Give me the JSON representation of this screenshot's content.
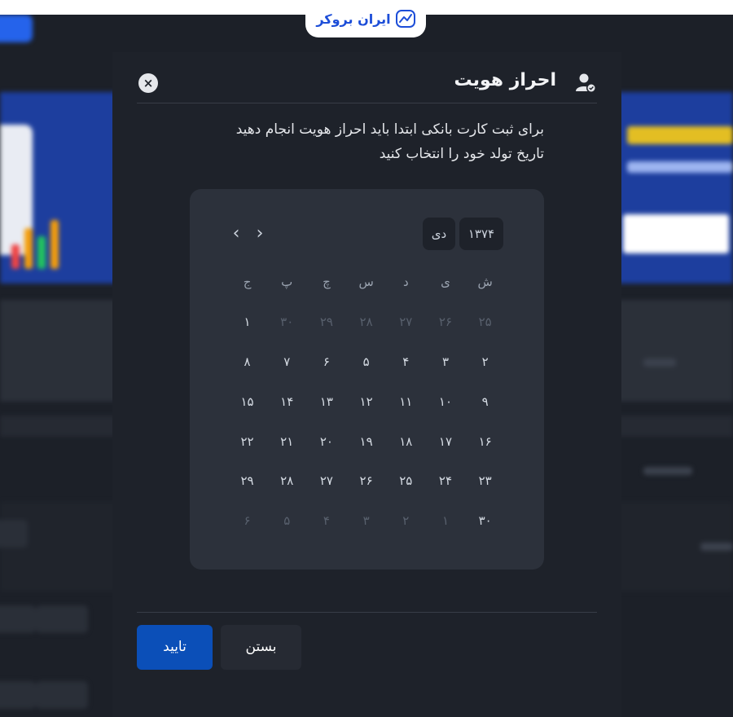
{
  "brand": {
    "logo_text": "ایران بروکر",
    "accent": "#1d4ed8"
  },
  "modal": {
    "title": "احراز هویت",
    "instruction_line1": "برای ثبت کارت بانکی ابتدا باید احراز هویت انجام دهید",
    "instruction_line2": "تاریخ تولد خود را انتخاب کنید",
    "confirm_label": "تایید",
    "close_label": "بستن",
    "close_icon": "×"
  },
  "calendar": {
    "year": "۱۳۷۴",
    "month": "دی",
    "prev_glyph": "‹",
    "next_glyph": "›",
    "weekdays": [
      "ش",
      "ی",
      "د",
      "س",
      "چ",
      "پ",
      "ج"
    ],
    "weeks": [
      [
        {
          "d": "۲۵",
          "muted": true
        },
        {
          "d": "۲۶",
          "muted": true
        },
        {
          "d": "۲۷",
          "muted": true
        },
        {
          "d": "۲۸",
          "muted": true
        },
        {
          "d": "۲۹",
          "muted": true
        },
        {
          "d": "۳۰",
          "muted": true
        },
        {
          "d": "۱",
          "muted": false
        }
      ],
      [
        {
          "d": "۲",
          "muted": false
        },
        {
          "d": "۳",
          "muted": false
        },
        {
          "d": "۴",
          "muted": false
        },
        {
          "d": "۵",
          "muted": false
        },
        {
          "d": "۶",
          "muted": false
        },
        {
          "d": "۷",
          "muted": false
        },
        {
          "d": "۸",
          "muted": false
        }
      ],
      [
        {
          "d": "۹",
          "muted": false
        },
        {
          "d": "۱۰",
          "muted": false
        },
        {
          "d": "۱۱",
          "muted": false
        },
        {
          "d": "۱۲",
          "muted": false
        },
        {
          "d": "۱۳",
          "muted": false
        },
        {
          "d": "۱۴",
          "muted": false
        },
        {
          "d": "۱۵",
          "muted": false
        }
      ],
      [
        {
          "d": "۱۶",
          "muted": false
        },
        {
          "d": "۱۷",
          "muted": false
        },
        {
          "d": "۱۸",
          "muted": false
        },
        {
          "d": "۱۹",
          "muted": false
        },
        {
          "d": "۲۰",
          "muted": false
        },
        {
          "d": "۲۱",
          "muted": false
        },
        {
          "d": "۲۲",
          "muted": false
        }
      ],
      [
        {
          "d": "۲۳",
          "muted": false
        },
        {
          "d": "۲۴",
          "muted": false
        },
        {
          "d": "۲۵",
          "muted": false
        },
        {
          "d": "۲۶",
          "muted": false
        },
        {
          "d": "۲۷",
          "muted": false
        },
        {
          "d": "۲۸",
          "muted": false
        },
        {
          "d": "۲۹",
          "muted": false
        }
      ],
      [
        {
          "d": "۳۰",
          "muted": false
        },
        {
          "d": "۱",
          "muted": true
        },
        {
          "d": "۲",
          "muted": true
        },
        {
          "d": "۳",
          "muted": true
        },
        {
          "d": "۴",
          "muted": true
        },
        {
          "d": "۵",
          "muted": true
        },
        {
          "d": "۶",
          "muted": true
        }
      ]
    ]
  },
  "colors": {
    "page_bg": "#1c2028",
    "modal_bg": "#1e222a",
    "calendar_bg": "#2c313b",
    "confirm_bg": "#0b4fb8",
    "close_bg": "#262a33"
  }
}
